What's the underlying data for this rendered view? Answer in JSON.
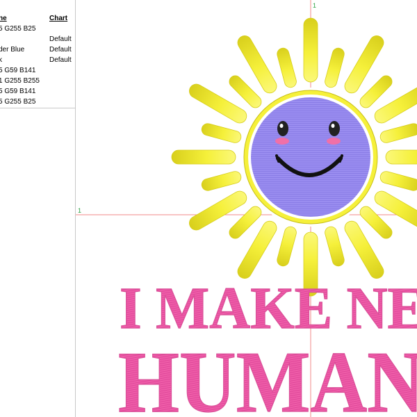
{
  "color_list": {
    "headers": {
      "name": "ne",
      "chart": "Chart"
    },
    "rows": [
      {
        "name": "5 G255 B25",
        "chart": ""
      },
      {
        "name": "",
        "chart": "Default"
      },
      {
        "name": "der Blue",
        "chart": "Default"
      },
      {
        "name": "k",
        "chart": "Default"
      },
      {
        "name": "5 G59 B141",
        "chart": ""
      },
      {
        "name": "1 G255 B255",
        "chart": ""
      },
      {
        "name": "5 G59 B141",
        "chart": ""
      },
      {
        "name": "5 G255 B25",
        "chart": ""
      }
    ]
  },
  "canvas": {
    "origin_label_top": "1",
    "origin_label_left": "1",
    "design_text": {
      "line1": "I MAKE NE",
      "line2": "HUMAN"
    }
  },
  "colors": {
    "sun_rays": "#f5f03a",
    "sun_face": "#9a8df0",
    "text_pink": "#ee5da8",
    "cheeks": "#f070a8",
    "guide_lines": "#f28a8a",
    "outline": "#2a2a2a"
  },
  "icons": [
    "sun-embroidery",
    "smiley-face"
  ]
}
